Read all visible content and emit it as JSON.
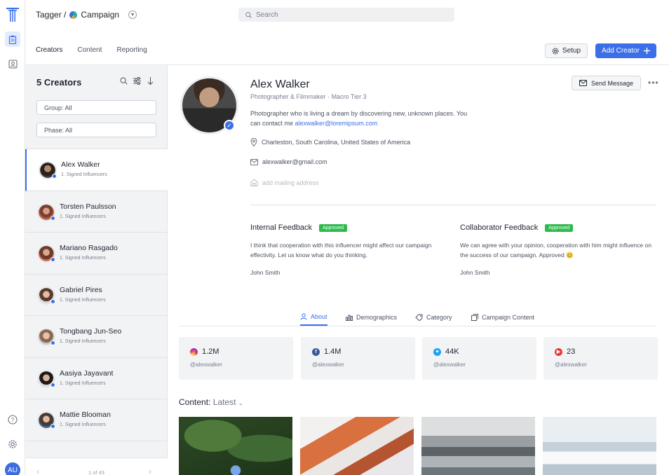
{
  "app": {
    "breadcrumb_root": "Tagger /",
    "breadcrumb_current": "Campaign",
    "search_placeholder": "Search",
    "user_initials": "AU"
  },
  "tabs": [
    {
      "label": "Creators",
      "active": true
    },
    {
      "label": "Content",
      "active": false
    },
    {
      "label": "Reporting",
      "active": false
    }
  ],
  "actions": {
    "setup_label": "Setup",
    "add_creator_label": "Add Creator"
  },
  "sidebar": {
    "heading": "5 Creators",
    "filter_group": "Group: All",
    "filter_phase": "Phase: All",
    "creators": [
      {
        "name": "Alex Walker",
        "group": "1. Signed Influencers",
        "selected": true
      },
      {
        "name": "Torsten Paulsson",
        "group": "1. Signed Influencers",
        "selected": false
      },
      {
        "name": "Mariano Rasgado",
        "group": "1. Signed Influencers",
        "selected": false
      },
      {
        "name": "Gabriel Pires",
        "group": "1. Signed Influencers",
        "selected": false
      },
      {
        "name": "Tongbang Jun-Seo",
        "group": "1. Signed Influencers",
        "selected": false
      },
      {
        "name": "Aasiya Jayavant",
        "group": "1. Signed Influencers",
        "selected": false
      },
      {
        "name": "Mattie Blooman",
        "group": "1. Signed Influencers",
        "selected": false
      }
    ],
    "pager": "1 of 43"
  },
  "profile": {
    "name": "Alex Walker",
    "role": "Photographer & Filmmaker",
    "tier": "Macro Tier 3",
    "bio": "Photographer who is living a dream by discovering new, unknown places. You can contact me",
    "bio_link": "alexwalker@loremipsum.com",
    "location": "Charleston, South Carolina, United States of America",
    "email": "alexwalker@gmail.com",
    "address_placeholder": "add mailing address",
    "send_message_label": "Send Message",
    "more_label": "•••"
  },
  "feedback": [
    {
      "title": "Internal Feedback",
      "status": "Approved",
      "text": "I think that cooperation with this influencer might affect our campaign effectivity. Let us know what do you thinking.",
      "author": "John Smith"
    },
    {
      "title": "Collaborator Feedback",
      "status": "Approved",
      "text": "We can agree with your opinion, cooperation with him might influence on the success of our campaign. Approved 😊",
      "author": "John Smith"
    }
  ],
  "profile_tabs": [
    {
      "label": "About",
      "active": true
    },
    {
      "label": "Demographics",
      "active": false
    },
    {
      "label": "Category",
      "active": false
    },
    {
      "label": "Campaign Content",
      "active": false
    }
  ],
  "stats": [
    {
      "platform": "instagram",
      "value": "1.2M",
      "handle": "@alexwalker",
      "color": "#d9317a"
    },
    {
      "platform": "facebook",
      "value": "1.4M",
      "handle": "@alexwalker",
      "color": "#3b5998"
    },
    {
      "platform": "twitter",
      "value": "44K",
      "handle": "@alexwalker",
      "color": "#1da1f2"
    },
    {
      "platform": "youtube",
      "value": "23",
      "handle": "@alexwalker",
      "color": "#e53935"
    }
  ],
  "content": {
    "label": "Content:",
    "filter": "Latest"
  },
  "colors": {
    "accent": "#3a6fe8",
    "approved": "#2dbb4c"
  }
}
